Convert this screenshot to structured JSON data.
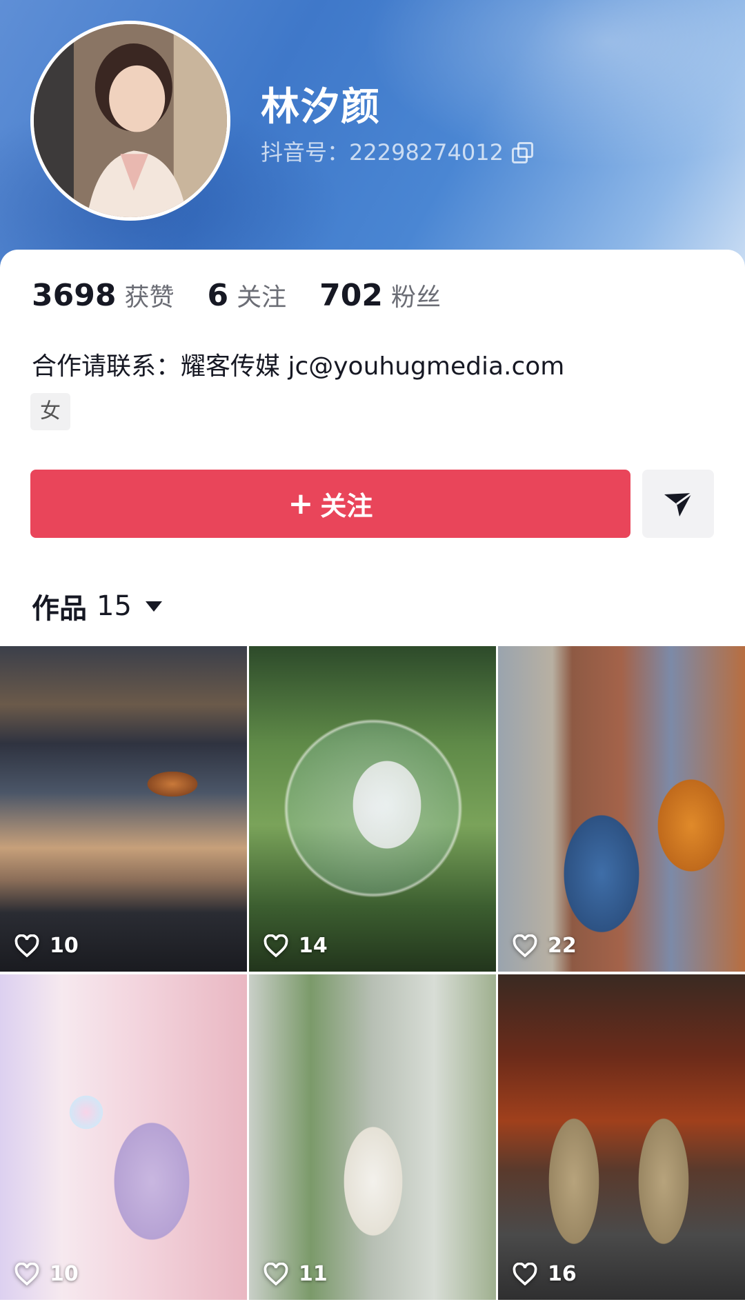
{
  "profile": {
    "name": "林汐颜",
    "douyin_id": "抖音号：22298274012"
  },
  "stats": [
    {
      "value": "3698",
      "label": "获赞"
    },
    {
      "value": "6",
      "label": "关注"
    },
    {
      "value": "702",
      "label": "粉丝"
    }
  ],
  "bio": "合作请联系：耀客传媒 jc@youhugmedia.com",
  "tag": "女",
  "actions": {
    "follow_plus": "+",
    "follow_label": "关注"
  },
  "works": {
    "label": "作品",
    "count": "15"
  },
  "videos": [
    {
      "likes": "10"
    },
    {
      "likes": "14"
    },
    {
      "likes": "22"
    },
    {
      "likes": "10"
    },
    {
      "likes": "11"
    },
    {
      "likes": "16"
    }
  ],
  "colors": {
    "accent": "#e9455a",
    "header_blue": "#3f78c9"
  },
  "icons": {
    "copy": "copy-icon",
    "send": "send-icon",
    "heart": "heart-icon",
    "caret": "caret-down-icon"
  }
}
